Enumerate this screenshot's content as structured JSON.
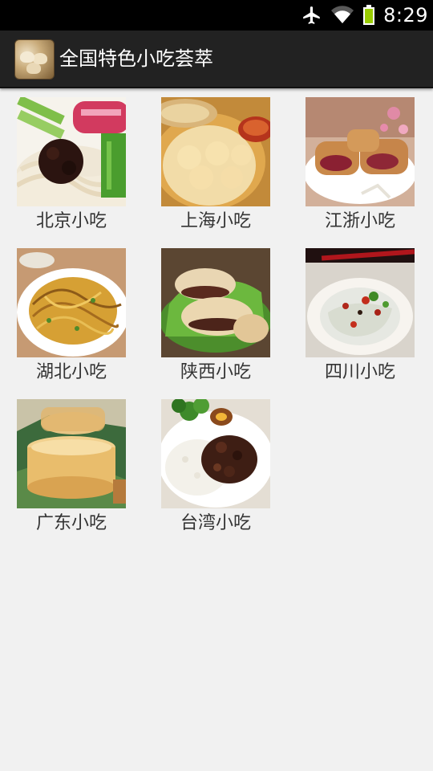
{
  "status_bar": {
    "time": "8:29",
    "icons": [
      "airplane-icon",
      "wifi-icon",
      "battery-icon"
    ]
  },
  "action_bar": {
    "title": "全国特色小吃荟萃",
    "icon": "app-logo-icon"
  },
  "grid": {
    "items": [
      {
        "label": "北京小吃"
      },
      {
        "label": "上海小吃"
      },
      {
        "label": "江浙小吃"
      },
      {
        "label": "湖北小吃"
      },
      {
        "label": "陕西小吃"
      },
      {
        "label": "四川小吃"
      },
      {
        "label": "广东小吃"
      },
      {
        "label": "台湾小吃"
      }
    ]
  },
  "colors": {
    "status_bar": "#000000",
    "action_bar": "#222222",
    "background": "#f1f1f1",
    "caption_text": "#333333",
    "battery": "#99cc00"
  }
}
